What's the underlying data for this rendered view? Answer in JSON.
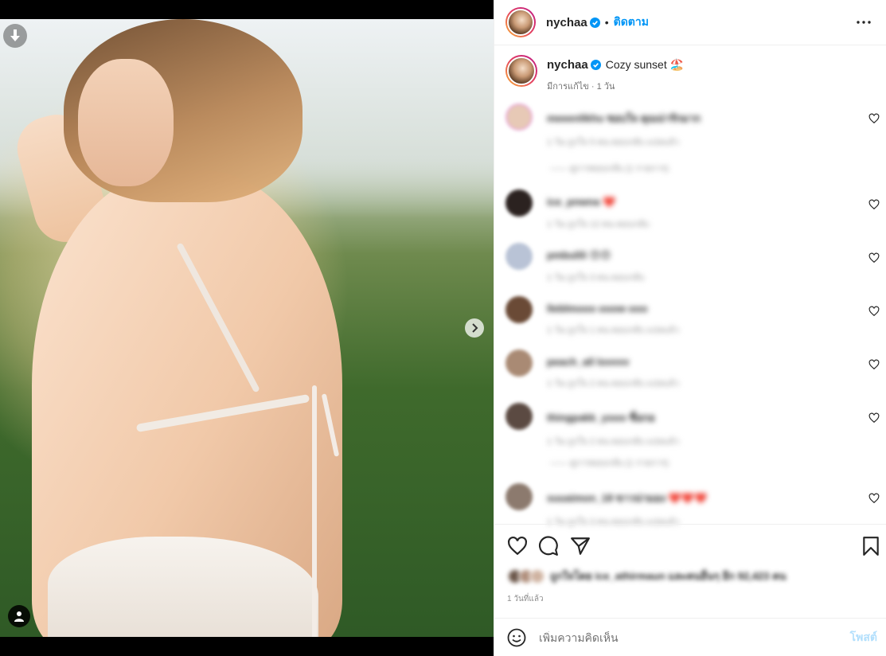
{
  "post": {
    "username": "nychaa",
    "follow_label": "ติดตาม",
    "separator": "•",
    "caption": "Cozy sunset 🏖️",
    "caption_meta": "มีการแก้ไข · 1 วัน",
    "posted_ago": "1 วันที่แล้ว"
  },
  "comments": [
    {
      "user": "meeenlikhu",
      "text": "ชอบใจ คุณน่ารักมาก",
      "meta": "1 วัน  ถูกใจ 5 คน  ตอบกลับ  แปลแล้ว",
      "avatar": "#e7c9b6"
    },
    {
      "user": "ice_pnwna",
      "text": "❤️",
      "meta": "1 วัน  ถูกใจ 12 คน  ตอบกลับ",
      "avatar": "#2b2220"
    },
    {
      "user": "pmbulili",
      "text": "😍😍",
      "meta": "1 วัน  ถูกใจ 3 คน  ตอบกลับ",
      "avatar": "#b9c3d6"
    },
    {
      "user": "lleblmooo",
      "text": "ooow ooo",
      "meta": "1 วัน  ถูกใจ 1 คน  ตอบกลับ  แปลแล้ว",
      "avatar": "#6a4a36"
    },
    {
      "user": "peach_all",
      "text": "lovvvv",
      "meta": "1 วัน  ถูกใจ 2 คน  ตอบกลับ  แปลแล้ว",
      "avatar": "#a98a74"
    },
    {
      "user": "thingpakk_yooo",
      "text": "ชื่อกอ",
      "meta": "1 วัน  ถูกใจ 2 คน  ตอบกลับ  แปลแล้ว",
      "avatar": "#5b4a42"
    },
    {
      "user": "suuaimon_18",
      "text": "ขาวน่ามอง ❤️❤️❤️",
      "meta": "1 วัน  ถูกใจ 3 คน  ตอบกลับ  แปลแล้ว",
      "avatar": "#8c7a6e"
    }
  ],
  "replies": [
    "—— ดูการตอบกลับ (1 รายการ)",
    "—— ดูการตอบกลับ (1 รายการ)"
  ],
  "likes": {
    "text": "ถูกใจโดย ice_athirmaun และคนอื่นๆ อีก 92,423 คน"
  },
  "composer": {
    "placeholder": "เพิ่มความคิดเห็น",
    "post_label": "โพสต์"
  },
  "colors": {
    "accent": "#0095f6",
    "post_disabled": "#b2dffc",
    "border": "#efefef"
  },
  "icons": [
    "download-icon",
    "chevron-right-icon",
    "user-tag-icon",
    "verified-icon",
    "more-icon",
    "heart-icon",
    "comment-icon",
    "share-icon",
    "bookmark-icon",
    "emoji-icon"
  ]
}
